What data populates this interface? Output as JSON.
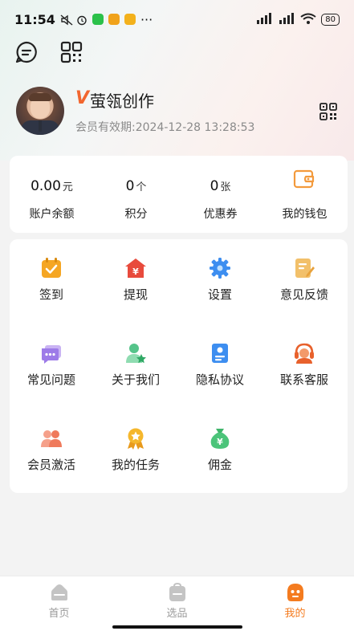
{
  "status_bar": {
    "time": "11:54",
    "battery": "80"
  },
  "colors": {
    "accent": "#f47b1f",
    "vip": "#f2662f",
    "background": "#f3f3f3"
  },
  "profile": {
    "vip_mark": "V",
    "name": "萤瓴创作",
    "expiry": "会员有效期:2024-12-28 13:28:53"
  },
  "wallet": {
    "balance": {
      "value": "0.00",
      "unit": "元",
      "label": "账户余额"
    },
    "points": {
      "value": "0",
      "unit": "个",
      "label": "积分"
    },
    "coupons": {
      "value": "0",
      "unit": "张",
      "label": "优惠券"
    },
    "my_wallet": {
      "label": "我的钱包",
      "icon": "wallet-icon"
    }
  },
  "menu": [
    {
      "label": "签到",
      "icon": "calendar-check-icon"
    },
    {
      "label": "提现",
      "icon": "withdraw-icon"
    },
    {
      "label": "设置",
      "icon": "gear-icon"
    },
    {
      "label": "意见反馈",
      "icon": "feedback-icon"
    },
    {
      "label": "常见问题",
      "icon": "chat-bubble-icon"
    },
    {
      "label": "关于我们",
      "icon": "user-star-icon"
    },
    {
      "label": "隐私协议",
      "icon": "document-icon"
    },
    {
      "label": "联系客服",
      "icon": "headset-icon"
    },
    {
      "label": "会员激活",
      "icon": "members-icon"
    },
    {
      "label": "我的任务",
      "icon": "medal-icon"
    },
    {
      "label": "佣金",
      "icon": "money-bag-icon"
    }
  ],
  "tabbar": [
    {
      "label": "首页",
      "icon": "home-icon"
    },
    {
      "label": "选品",
      "icon": "bag-icon"
    },
    {
      "label": "我的",
      "icon": "profile-icon",
      "active": true
    }
  ]
}
